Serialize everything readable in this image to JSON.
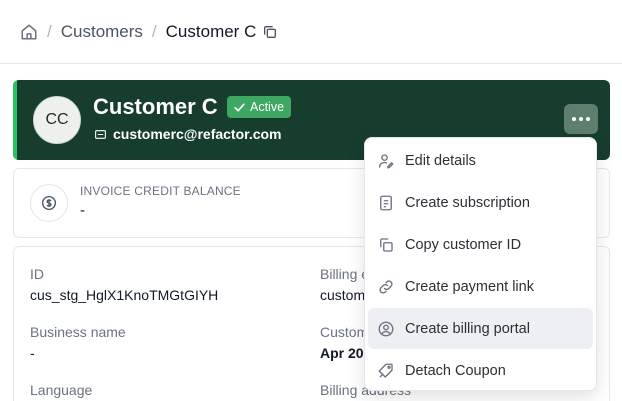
{
  "breadcrumb": {
    "items": [
      "Customers",
      "Customer C"
    ],
    "separator": "/"
  },
  "customer": {
    "initials": "CC",
    "name": "Customer C",
    "status": "Active",
    "email": "customerc@refactor.com"
  },
  "credit": {
    "label": "INVOICE CREDIT BALANCE",
    "value": "-"
  },
  "details": {
    "id_label": "ID",
    "id_value": "cus_stg_HglX1KnoTMGtGIYH",
    "business_label": "Business name",
    "business_value": "-",
    "language_label": "Language",
    "billing_label": "Billing e",
    "billing_value": "custom",
    "customer_since_label": "Custom",
    "customer_since_value": "Apr 20",
    "billing_address_label": "Billing address"
  },
  "menu": {
    "items": [
      {
        "label": "Edit details",
        "icon": "user-edit-icon"
      },
      {
        "label": "Create subscription",
        "icon": "subscription-doc-icon"
      },
      {
        "label": "Copy customer ID",
        "icon": "copy-icon"
      },
      {
        "label": "Create payment link",
        "icon": "link-icon"
      },
      {
        "label": "Create billing portal",
        "icon": "user-circle-icon"
      },
      {
        "label": "Detach Coupon",
        "icon": "tag-remove-icon"
      }
    ]
  },
  "colors": {
    "header_bg": "#163d2e",
    "accent": "#22c55e",
    "badge": "#3ea863"
  }
}
